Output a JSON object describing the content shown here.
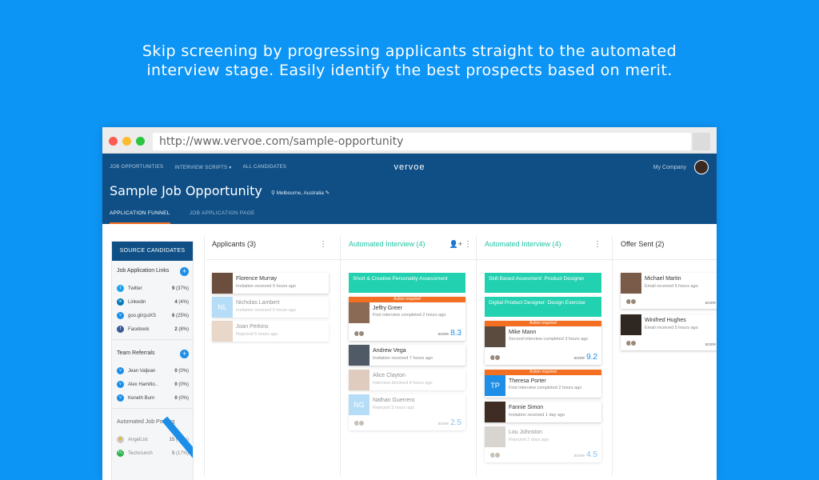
{
  "headline": {
    "line1": "Skip screening by progressing applicants straight to the automated",
    "line2": "interview stage. Easily identify the best prospects based on merit."
  },
  "browser": {
    "url": "http://www.vervoe.com/sample-opportunity"
  },
  "header": {
    "nav": [
      "JOB OPPORTUNITIES",
      "INTERVIEW SCRIPTS ▾",
      "ALL CANDIDATES"
    ],
    "logo": "vervoe",
    "company": "My Company",
    "job_title": "Sample Job Opportunity",
    "location": "Melbourne, Australia",
    "tabs": [
      "APPLICATION FUNNEL",
      "JOB APPLICATION PAGE"
    ]
  },
  "sidebar": {
    "source_button": "SOURCE CANDIDATES",
    "links_title": "Job Application Links",
    "links": [
      {
        "label": "Twitter",
        "count": "9",
        "pct": "(37%)",
        "color": "#1da1f2"
      },
      {
        "label": "Linkedin",
        "count": "4",
        "pct": "(4%)",
        "color": "#0077b5"
      },
      {
        "label": "goo.gl/cjuiXS",
        "count": "6",
        "pct": "(25%)",
        "color": "#1b8fe8"
      },
      {
        "label": "Facebook",
        "count": "2",
        "pct": "(8%)",
        "color": "#3b5998"
      }
    ],
    "referrals_title": "Team Referrals",
    "referrals": [
      {
        "label": "Jean Valjean",
        "count": "0",
        "pct": "(0%)"
      },
      {
        "label": "Alex Hamilto..",
        "count": "0",
        "pct": "(0%)"
      },
      {
        "label": "Keneth Burn",
        "count": "0",
        "pct": "(0%)"
      }
    ],
    "posting_title": "Automated Job Posting",
    "postings": [
      {
        "label": "AngelList",
        "count": "15",
        "pct": "(60%)"
      },
      {
        "label": "Techcrunch",
        "count": "5",
        "pct": "(17%)"
      }
    ]
  },
  "columns": [
    {
      "title": "Applicants (3)",
      "color": "#333333"
    },
    {
      "title": "Automated Interview (4)",
      "color": "#21c6a6"
    },
    {
      "title": "Automated Interview (4)",
      "color": "#21c6a6"
    },
    {
      "title": "Offer Sent (2)",
      "color": "#333333"
    }
  ],
  "applicants": [
    {
      "name": "Florence Murray",
      "sub": "Invitation received 5 hours ago"
    },
    {
      "name": "Nicholas Lambert",
      "sub": "Invitation received 5 hours ago",
      "initials": "NL"
    },
    {
      "name": "Joan Perkins",
      "sub": "Rejected 5 hours ago"
    }
  ],
  "interview1": {
    "header": "Short & Creative Personality Assessment",
    "action": "Action required",
    "score_label": "score",
    "cards": [
      {
        "name": "Jeffry Greer",
        "sub": "First interview completed 2 hours ago",
        "score": "8.3"
      },
      {
        "name": "Andrew Vega",
        "sub": "Invitation received 7 hours ago"
      },
      {
        "name": "Alice Clayton",
        "sub": "Interview declined 4 hours ago"
      },
      {
        "name": "Nathan Guerrero",
        "sub": "Rejected 3 hours ago",
        "initials": "NG",
        "score": "2.5"
      }
    ]
  },
  "interview2": {
    "headers": [
      "Skill Based Assesment: Product Designer",
      "Digital Product Designer: Design Exercise"
    ],
    "action": "Action required",
    "score_label": "score",
    "cards": [
      {
        "name": "Mike Mann",
        "sub": "Second interview completed 3 hours ago",
        "score": "9.2"
      },
      {
        "name": "Theresa Porter",
        "sub": "First interview completed 2 hours ago",
        "initials": "TP"
      },
      {
        "name": "Fannie Simon",
        "sub": "Invitation received 1 day ago"
      },
      {
        "name": "Lou Johnston",
        "sub": "Rejected 2 days ago",
        "score": "4.5"
      }
    ]
  },
  "offers": {
    "score_label": "score",
    "cards": [
      {
        "name": "Michael Martin",
        "sub": "Email received 5 hours ago"
      },
      {
        "name": "Winifred Hughes",
        "sub": "Email received 5 hours ago"
      }
    ]
  }
}
